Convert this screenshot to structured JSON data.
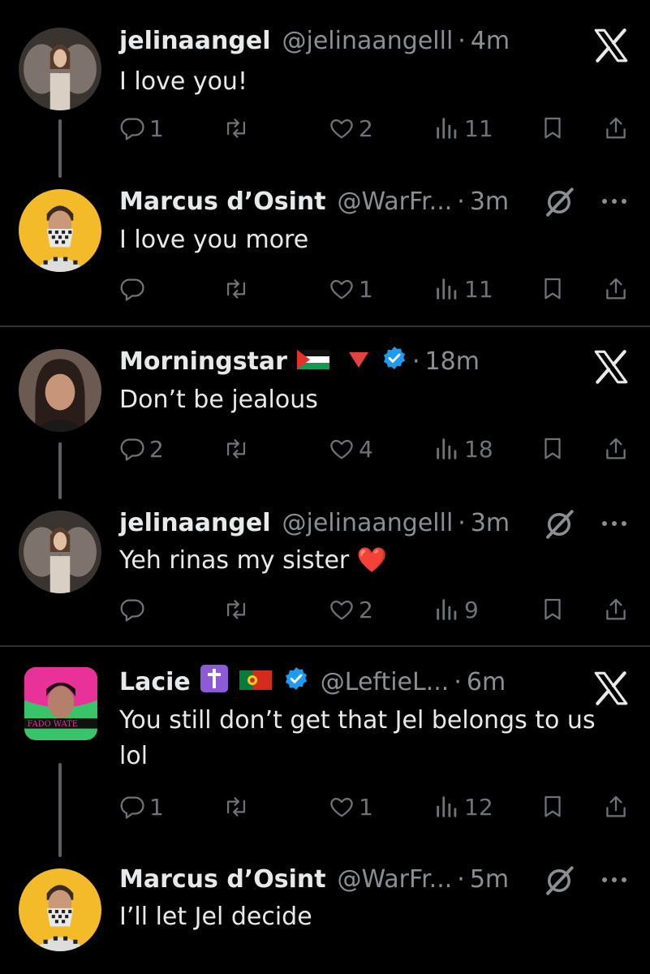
{
  "colors": {
    "background": "#000000",
    "text": "#e7e9ea",
    "muted": "#8b8f94",
    "icon": "#6f7378",
    "verified": "#1d9bf0",
    "divider": "#2f3336"
  },
  "tweets": [
    {
      "name": "jelinaangel",
      "handle": "@jelinaangelll",
      "dot": "·",
      "time": "4m",
      "text": "I love you!",
      "reply": "1",
      "retweet": "",
      "like": "2",
      "views": "11",
      "badge": "x-close-icon"
    },
    {
      "name": "Marcus d’Osint",
      "handle": "@WarFr...",
      "dot": "·",
      "time": "3m",
      "text": "I love you more",
      "reply": "",
      "retweet": "",
      "like": "1",
      "views": "11",
      "badge": "grok-icon"
    },
    {
      "name": "Morningstar",
      "handle": "",
      "dot": "·",
      "time": "18m",
      "text": "Don’t be jealous",
      "reply": "2",
      "retweet": "",
      "like": "4",
      "views": "18",
      "badge": "x-close-icon"
    },
    {
      "name": "jelinaangel",
      "handle": "@jelinaangelll",
      "dot": "·",
      "time": "3m",
      "text": "Yeh rinas my sister ❤️",
      "reply": "",
      "retweet": "",
      "like": "2",
      "views": "9",
      "badge": "grok-icon"
    },
    {
      "name": "Lacie",
      "handle": "@LeftieL...",
      "dot": "·",
      "time": "6m",
      "text": "You still don’t get that Jel belongs to us lol",
      "reply": "1",
      "retweet": "",
      "like": "1",
      "views": "12",
      "badge": "x-close-icon"
    },
    {
      "name": "Marcus d’Osint",
      "handle": "@WarFr...",
      "dot": "·",
      "time": "5m",
      "text": "I’ll let Jel decide",
      "reply": "",
      "retweet": "",
      "like": "",
      "views": "",
      "badge": "grok-icon"
    }
  ],
  "icons": {
    "reply": "reply-icon",
    "retweet": "retweet-icon",
    "like": "heart-icon",
    "views": "views-icon",
    "bookmark": "bookmark-icon",
    "share": "share-icon",
    "more": "more-icon",
    "verified": "verified-badge-icon"
  }
}
